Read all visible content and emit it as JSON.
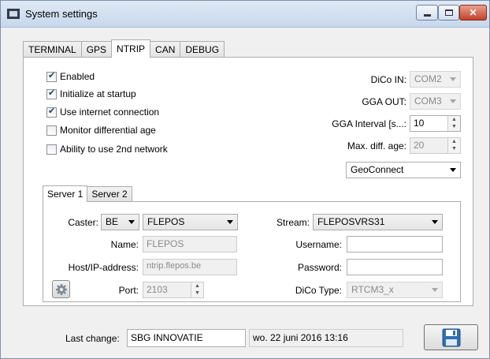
{
  "window": {
    "title": "System settings",
    "controls": {
      "minimize": "",
      "maximize": "",
      "close": "✕"
    }
  },
  "tabs": [
    {
      "label": "TERMINAL"
    },
    {
      "label": "GPS"
    },
    {
      "label": "NTRIP",
      "active": true
    },
    {
      "label": "CAN"
    },
    {
      "label": "DEBUG"
    }
  ],
  "ntrip": {
    "checkboxes": [
      {
        "label": "Enabled",
        "checked": true
      },
      {
        "label": "Initialize at startup",
        "checked": true
      },
      {
        "label": "Use internet connection",
        "checked": true
      },
      {
        "label": "Monitor differential age",
        "checked": false
      },
      {
        "label": "Ability to use 2nd network",
        "checked": false
      }
    ],
    "dico_in": {
      "label": "DiCo IN:",
      "value": "COM2"
    },
    "gga_out": {
      "label": "GGA OUT:",
      "value": "COM3"
    },
    "gga_interval": {
      "label": "GGA Interval [s...:",
      "value": "10"
    },
    "max_diff_age": {
      "label": "Max. diff. age:",
      "value": "20"
    },
    "service": {
      "value": "GeoConnect"
    }
  },
  "server_tabs": [
    {
      "label": "Server 1",
      "active": true
    },
    {
      "label": "Server 2"
    }
  ],
  "server": {
    "caster_label": "Caster:",
    "caster_country": "BE",
    "caster_value": "FLEPOS",
    "name_label": "Name:",
    "name_value": "FLEPOS",
    "host_label": "Host/IP-address:",
    "host_value": "ntrip.flepos.be",
    "port_label": "Port:",
    "port_value": "2103",
    "stream_label": "Stream:",
    "stream_value": "FLEPOSVRS31",
    "username_label": "Username:",
    "username_value": "",
    "password_label": "Password:",
    "password_value": "",
    "dico_type_label": "DiCo Type:",
    "dico_type_value": "RTCM3_x"
  },
  "footer": {
    "last_change_label": "Last change:",
    "last_change_by": "SBG INNOVATIE",
    "last_change_date": "wo. 22 juni 2016 13:16"
  },
  "colors": {
    "titlebar": "#c7d8ec",
    "close": "#c2422a",
    "save_icon": "#2e6fb3"
  }
}
